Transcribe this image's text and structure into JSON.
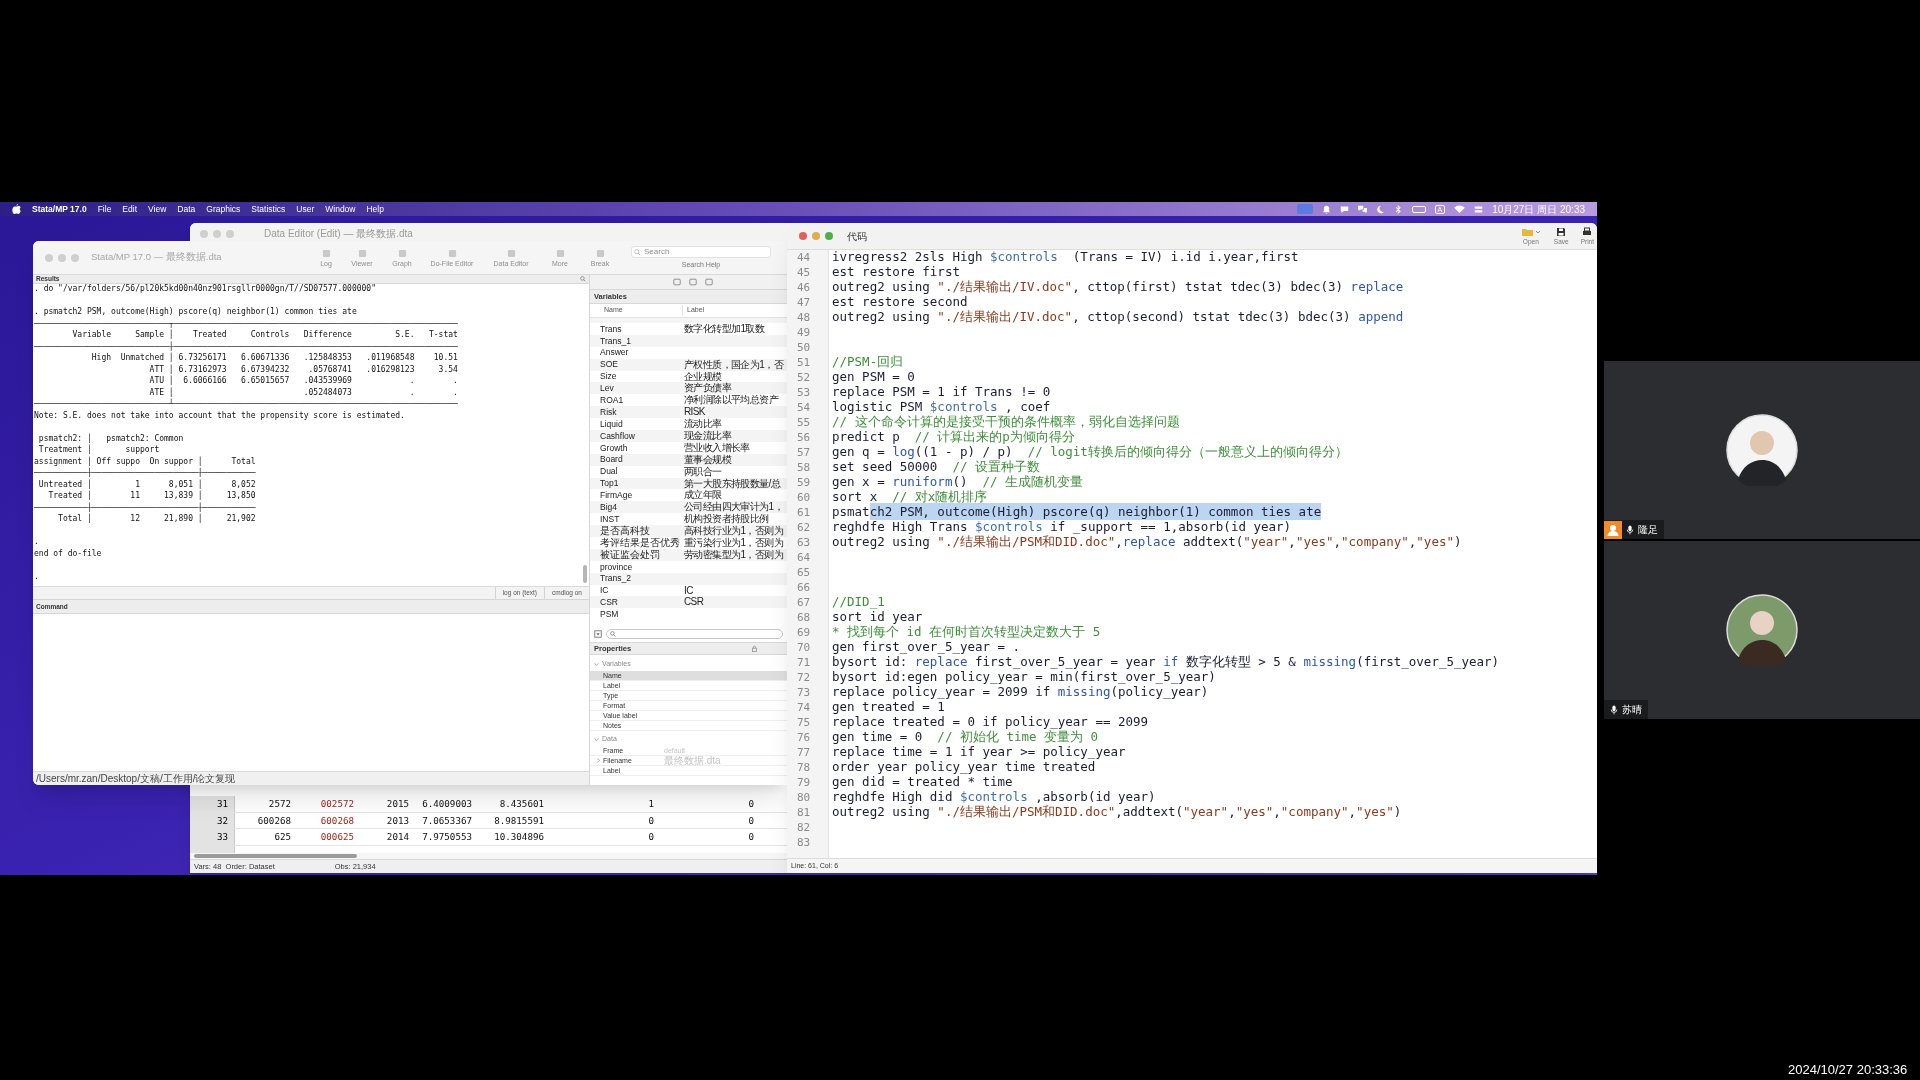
{
  "menu_bar": {
    "app": "Stata/MP 17.0",
    "menus": [
      "File",
      "Edit",
      "View",
      "Data",
      "Graphics",
      "Statistics",
      "User",
      "Window",
      "Help"
    ],
    "input_method": "A",
    "clock": "10月27日 周日 20:33"
  },
  "data_editor": {
    "title": "Data Editor (Edit) — 最终数据.dta",
    "columns": [
      {
        "kind": "number"
      },
      {
        "kind": "string"
      },
      {
        "kind": "number"
      },
      {
        "kind": "number"
      },
      {
        "kind": "number"
      },
      {
        "kind": "number"
      },
      {
        "kind": "number"
      }
    ],
    "rows": [
      {
        "num": "31",
        "cells": [
          "2572",
          "002572",
          "2015",
          "6.4009003",
          "8.435601",
          "1",
          "0"
        ]
      },
      {
        "num": "32",
        "cells": [
          "600268",
          "600268",
          "2013",
          "7.0653367",
          "8.9815591",
          "0",
          "0"
        ]
      },
      {
        "num": "33",
        "cells": [
          "625",
          "000625",
          "2014",
          "7.9750553",
          "10.304896",
          "0",
          "0"
        ]
      }
    ],
    "status": [
      "Vars: 48  Order: Dataset",
      "Obs: 21,934"
    ]
  },
  "stata_window": {
    "title": "Stata/MP 17.0 — 最终数据.dta",
    "toolbar": [
      "Log",
      "Viewer",
      "Graph",
      "Do-File Editor",
      "Data Editor",
      "More",
      "Break"
    ],
    "search": {
      "placeholder": "Search"
    },
    "search_help": "Search Help",
    "results": {
      "header": "Results",
      "blocks": [
        [
          ". do \"/var/folders/56/pl20k5kd00n40nz901rsgllr0000gn/T//SD07577.000000\""
        ],
        [
          ". psmatch2 PSM, outcome(High) pscore(q) neighbor(1) common ties ate",
          "────────────────────────────┬───────────────────────────────────────────────────────────",
          "        Variable     Sample │    Treated     Controls   Difference         S.E.   T-stat",
          "────────────────────────────┼───────────────────────────────────────────────────────────",
          "            High  Unmatched │ 6.73256171   6.60671336   .125848353   .011968548    10.51",
          "                        ATT │ 6.73162973   6.67394232    .05768741   .016298123     3.54",
          "                        ATU │  6.6066166   6.65015657   .043539969            .        .",
          "                        ATE │                           .052484073            .        .",
          "────────────────────────────┴───────────────────────────────────────────────────────────",
          "Note: S.E. does not take into account that the propensity score is estimated."
        ],
        [
          " psmatch2: │   psmatch2: Common",
          " Treatment │       support",
          "assignment │ Off suppo  On suppor │      Total",
          "───────────┼──────────────────────┼───────────",
          " Untreated │         1      8,051 │      8,052",
          "   Treated │        11     13,839 │     13,850",
          "───────────┼──────────────────────┼───────────",
          "     Total │        12     21,890 │     21,902"
        ],
        [
          ".",
          "end of do-file"
        ],
        [
          "."
        ]
      ]
    },
    "log_buttons": [
      "log on (text)",
      "cmdlog on"
    ],
    "command": {
      "header": "Command"
    },
    "cwd": "/Users/mr.zan/Desktop/文稿/工作用/论文复现",
    "variables": {
      "header": "Variables",
      "columns": [
        "Name",
        "Label"
      ],
      "rows": [
        {
          "name": "Trans",
          "label": "数字化转型加1取数"
        },
        {
          "name": "Trans_1"
        },
        {
          "name": "Answer"
        },
        {
          "name": "SOE",
          "label": "产权性质，国企为1，否"
        },
        {
          "name": "Size",
          "label": "企业规模"
        },
        {
          "name": "Lev",
          "label": "资产负债率"
        },
        {
          "name": "ROA1",
          "label": "净利润除以平均总资产"
        },
        {
          "name": "Risk",
          "label": "RISK"
        },
        {
          "name": "Liquid",
          "label": "流动比率"
        },
        {
          "name": "Cashflow",
          "label": "现金流比率"
        },
        {
          "name": "Growth",
          "label": "营业收入增长率"
        },
        {
          "name": "Board",
          "label": "董事会规模"
        },
        {
          "name": "Dual",
          "label": "两职合一"
        },
        {
          "name": "Top1",
          "label": "第一大股东持股数量/总"
        },
        {
          "name": "FirmAge",
          "label": "成立年限"
        },
        {
          "name": "Big4",
          "label": "公司经由四大审计为1，"
        },
        {
          "name": "INST",
          "label": "机构投资者持股比例"
        },
        {
          "name": "是否高科技",
          "label": "高科技行业为1，否则为"
        },
        {
          "name": "考评结果是否优秀",
          "label": "重污染行业为1，否则为"
        },
        {
          "name": "被证监会处罚",
          "label": "劳动密集型为1，否则为"
        },
        {
          "name": "province"
        },
        {
          "name": "Trans_2"
        },
        {
          "name": "IC",
          "label": "IC"
        },
        {
          "name": "CSR",
          "label": "CSR"
        },
        {
          "name": "PSM"
        }
      ]
    },
    "properties": {
      "header": "Properties",
      "sections": [
        {
          "title": "Variables",
          "expanded": true,
          "rows": [
            {
              "label": "Name",
              "selected": true
            },
            {
              "label": "Label",
              "selected": false
            },
            {
              "label": "Type",
              "selected": false
            },
            {
              "label": "Format",
              "selected": false
            },
            {
              "label": "Value label",
              "selected": false
            },
            {
              "label": "Notes",
              "selected": false
            }
          ]
        },
        {
          "title": "Data",
          "expanded": true,
          "rows": [
            {
              "label": "Frame",
              "value": "default",
              "selected": false
            },
            {
              "label": "Filename",
              "value": "最终数据.dta",
              "selected": false,
              "expandable": true
            },
            {
              "label": "Label",
              "selected": false
            }
          ]
        }
      ]
    }
  },
  "code_editor": {
    "title": "代码",
    "toolbar": [
      "Open",
      "Save",
      "Print"
    ],
    "lines": [
      {
        "n": "44",
        "seg": [
          {
            "text": "ivregress2 2sls High ",
            "kind": "plain"
          },
          {
            "text": "$controls",
            "kind": "macro"
          },
          {
            "text": "  (Trans = IV) i.id i.year,first",
            "kind": "plain"
          }
        ]
      },
      {
        "n": "45",
        "seg": [
          {
            "text": "est restore first",
            "kind": "plain"
          }
        ]
      },
      {
        "n": "46",
        "seg": [
          {
            "text": "outreg2 using ",
            "kind": "plain"
          },
          {
            "text": "\"./结果输出/IV.doc\"",
            "kind": "string"
          },
          {
            "text": ", cttop(first) tstat tdec(3) bdec(3) ",
            "kind": "plain"
          },
          {
            "text": "replace",
            "kind": "keyword"
          }
        ]
      },
      {
        "n": "47",
        "seg": [
          {
            "text": "est restore second",
            "kind": "plain"
          }
        ]
      },
      {
        "n": "48",
        "seg": [
          {
            "text": "outreg2 using ",
            "kind": "plain"
          },
          {
            "text": "\"./结果输出/IV.doc\"",
            "kind": "string"
          },
          {
            "text": ", cttop(second) tstat tdec(3) bdec(3) ",
            "kind": "plain"
          },
          {
            "text": "append",
            "kind": "keyword"
          }
        ]
      },
      {
        "n": "49"
      },
      {
        "n": "50"
      },
      {
        "n": "51",
        "seg": [
          {
            "text": "//PSM-回归",
            "kind": "comment"
          }
        ]
      },
      {
        "n": "52",
        "seg": [
          {
            "text": "gen PSM = 0",
            "kind": "plain"
          }
        ]
      },
      {
        "n": "53",
        "seg": [
          {
            "text": "replace PSM = 1 if Trans != 0",
            "kind": "plain"
          }
        ]
      },
      {
        "n": "54",
        "seg": [
          {
            "text": "logistic PSM ",
            "kind": "plain"
          },
          {
            "text": "$controls",
            "kind": "macro"
          },
          {
            "text": " , coef",
            "kind": "plain"
          }
        ]
      },
      {
        "n": "55",
        "seg": [
          {
            "text": "// 这个命令计算的是接受干预的条件概率，弱化自选择问题",
            "kind": "comment"
          }
        ]
      },
      {
        "n": "56",
        "seg": [
          {
            "text": "predict p  ",
            "kind": "plain"
          },
          {
            "text": "// 计算出来的p为倾向得分",
            "kind": "comment"
          }
        ]
      },
      {
        "n": "57",
        "seg": [
          {
            "text": "gen q = ",
            "kind": "plain"
          },
          {
            "text": "log",
            "kind": "keyword"
          },
          {
            "text": "((1 - p) / p)  ",
            "kind": "plain"
          },
          {
            "text": "// logit转换后的倾向得分（一般意义上的倾向得分）",
            "kind": "comment"
          }
        ]
      },
      {
        "n": "58",
        "seg": [
          {
            "text": "set seed 50000  ",
            "kind": "plain"
          },
          {
            "text": "// 设置种子数",
            "kind": "comment"
          }
        ]
      },
      {
        "n": "59",
        "seg": [
          {
            "text": "gen x = ",
            "kind": "plain"
          },
          {
            "text": "runiform",
            "kind": "keyword"
          },
          {
            "text": "()  ",
            "kind": "plain"
          },
          {
            "text": "// 生成随机变量",
            "kind": "comment"
          }
        ]
      },
      {
        "n": "60",
        "seg": [
          {
            "text": "sort x  ",
            "kind": "plain"
          },
          {
            "text": "// 对x随机排序",
            "kind": "comment"
          }
        ]
      },
      {
        "n": "61",
        "seg": [
          {
            "text": "psmat",
            "kind": "plain"
          },
          {
            "text": "ch2 PSM, outcome(High) pscore(q) neighbor(1) common ties ate",
            "kind": "selection"
          }
        ]
      },
      {
        "n": "62",
        "seg": [
          {
            "text": "reghdfe High Trans ",
            "kind": "plain"
          },
          {
            "text": "$controls",
            "kind": "macro"
          },
          {
            "text": " if _support == 1,absorb(id year)",
            "kind": "plain"
          }
        ]
      },
      {
        "n": "63",
        "seg": [
          {
            "text": "outreg2 using ",
            "kind": "plain"
          },
          {
            "text": "\"./结果输出/PSM和DID.doc\"",
            "kind": "string"
          },
          {
            "text": ",",
            "kind": "plain"
          },
          {
            "text": "replace",
            "kind": "keyword"
          },
          {
            "text": " addtext(",
            "kind": "plain"
          },
          {
            "text": "\"year\"",
            "kind": "string"
          },
          {
            "text": ",",
            "kind": "plain"
          },
          {
            "text": "\"yes\"",
            "kind": "string"
          },
          {
            "text": ",",
            "kind": "plain"
          },
          {
            "text": "\"company\"",
            "kind": "string"
          },
          {
            "text": ",",
            "kind": "plain"
          },
          {
            "text": "\"yes\"",
            "kind": "string"
          },
          {
            "text": ")",
            "kind": "plain"
          }
        ]
      },
      {
        "n": "64"
      },
      {
        "n": "65"
      },
      {
        "n": "66"
      },
      {
        "n": "67",
        "seg": [
          {
            "text": "//DID_1",
            "kind": "comment"
          }
        ]
      },
      {
        "n": "68",
        "seg": [
          {
            "text": "sort id year",
            "kind": "plain"
          }
        ]
      },
      {
        "n": "69",
        "seg": [
          {
            "text": "* 找到每个 id 在何时首次转型决定数大于 5",
            "kind": "comment"
          }
        ]
      },
      {
        "n": "70",
        "seg": [
          {
            "text": "gen first_over_5_year = .",
            "kind": "plain"
          }
        ]
      },
      {
        "n": "71",
        "seg": [
          {
            "text": "bysort id: ",
            "kind": "plain"
          },
          {
            "text": "replace",
            "kind": "keyword"
          },
          {
            "text": " first_over_5_year = year ",
            "kind": "plain"
          },
          {
            "text": "if",
            "kind": "keyword"
          },
          {
            "text": " 数字化转型 > 5 & ",
            "kind": "plain"
          },
          {
            "text": "missing",
            "kind": "keyword"
          },
          {
            "text": "(first_over_5_year)",
            "kind": "plain"
          }
        ]
      },
      {
        "n": "72",
        "seg": [
          {
            "text": "bysort id:egen policy_year = min(first_over_5_year)",
            "kind": "plain"
          }
        ]
      },
      {
        "n": "73",
        "seg": [
          {
            "text": "replace policy_year = 2099 if ",
            "kind": "plain"
          },
          {
            "text": "missing",
            "kind": "keyword"
          },
          {
            "text": "(policy_year)",
            "kind": "plain"
          }
        ]
      },
      {
        "n": "74",
        "seg": [
          {
            "text": "gen treated = 1",
            "kind": "plain"
          }
        ]
      },
      {
        "n": "75",
        "seg": [
          {
            "text": "replace treated = 0 if policy_year == 2099",
            "kind": "plain"
          }
        ]
      },
      {
        "n": "76",
        "seg": [
          {
            "text": "gen time = 0  ",
            "kind": "plain"
          },
          {
            "text": "// 初始化 time 变量为 0",
            "kind": "comment"
          }
        ]
      },
      {
        "n": "77",
        "seg": [
          {
            "text": "replace time = 1 if year >= policy_year",
            "kind": "plain"
          }
        ]
      },
      {
        "n": "78",
        "seg": [
          {
            "text": "order year policy_year time treated",
            "kind": "plain"
          }
        ]
      },
      {
        "n": "79",
        "seg": [
          {
            "text": "gen did = treated * time",
            "kind": "plain"
          }
        ]
      },
      {
        "n": "80",
        "seg": [
          {
            "text": "reghdfe High did ",
            "kind": "plain"
          },
          {
            "text": "$controls",
            "kind": "macro"
          },
          {
            "text": " ,absorb(id year)",
            "kind": "plain"
          }
        ]
      },
      {
        "n": "81",
        "seg": [
          {
            "text": "outreg2 using ",
            "kind": "plain"
          },
          {
            "text": "\"./结果输出/PSM和DID.doc\"",
            "kind": "string"
          },
          {
            "text": ",addtext(",
            "kind": "plain"
          },
          {
            "text": "\"year\"",
            "kind": "string"
          },
          {
            "text": ",",
            "kind": "plain"
          },
          {
            "text": "\"yes\"",
            "kind": "string"
          },
          {
            "text": ",",
            "kind": "plain"
          },
          {
            "text": "\"company\"",
            "kind": "string"
          },
          {
            "text": ",",
            "kind": "plain"
          },
          {
            "text": "\"yes\"",
            "kind": "string"
          },
          {
            "text": ")",
            "kind": "plain"
          }
        ]
      },
      {
        "n": "82"
      },
      {
        "n": "83"
      }
    ],
    "status": "Line: 61, Col: 6"
  },
  "participants": [
    {
      "name": "隆足",
      "host": true
    },
    {
      "name": "苏晴",
      "host": false
    }
  ],
  "timestamp": "2024/10/27 20:33:36"
}
